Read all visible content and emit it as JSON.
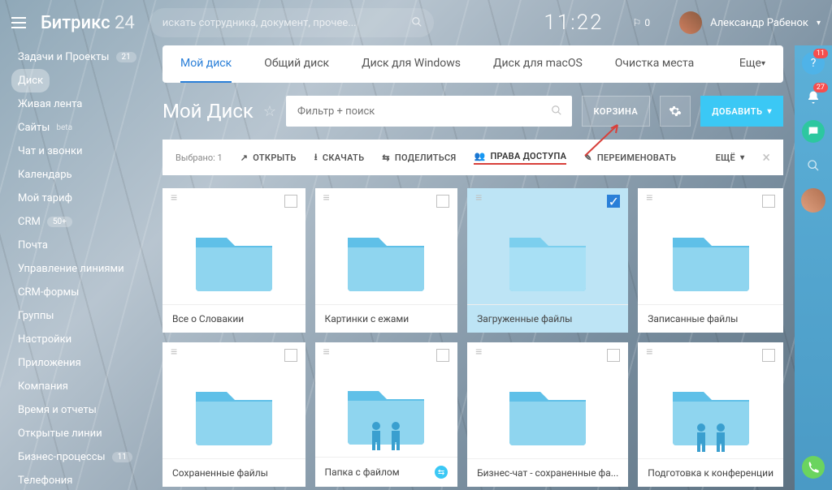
{
  "logo": {
    "main": "Битрикс",
    "sub": "24"
  },
  "search_placeholder": "искать сотрудника, документ, прочее...",
  "clock": "11:22",
  "cart_count": "0",
  "user": {
    "name": "Александр Рабенок"
  },
  "sidebar": [
    {
      "label": "Задачи и Проекты",
      "badge": "21"
    },
    {
      "label": "Диск",
      "active": true
    },
    {
      "label": "Живая лента"
    },
    {
      "label": "Сайты",
      "beta": "beta"
    },
    {
      "label": "Чат и звонки"
    },
    {
      "label": "Календарь"
    },
    {
      "label": "Мой тариф"
    },
    {
      "label": "CRM",
      "badge": "50+"
    },
    {
      "label": "Почта"
    },
    {
      "label": "Управление линиями"
    },
    {
      "label": "CRM-формы"
    },
    {
      "label": "Группы"
    },
    {
      "label": "Настройки"
    },
    {
      "label": "Приложения"
    },
    {
      "label": "Компания"
    },
    {
      "label": "Время и отчеты"
    },
    {
      "label": "Открытые линии"
    },
    {
      "label": "Бизнес-процессы",
      "badge": "11"
    },
    {
      "label": "Телефония"
    }
  ],
  "tabs": [
    {
      "label": "Мой диск",
      "active": true
    },
    {
      "label": "Общий диск"
    },
    {
      "label": "Диск для Windows"
    },
    {
      "label": "Диск для macOS"
    },
    {
      "label": "Очистка места"
    },
    {
      "label": "Еще",
      "more": true
    }
  ],
  "page_title": "Мой Диск",
  "filter_placeholder": "Фильтр + поиск",
  "btn_trash": "КОРЗИНА",
  "btn_add": "ДОБАВИТЬ",
  "selected_text": "Выбрано: 1",
  "actions": [
    {
      "label": "ОТКРЫТЬ",
      "icon": "open"
    },
    {
      "label": "СКАЧАТЬ",
      "icon": "download"
    },
    {
      "label": "ПОДЕЛИТЬСЯ",
      "icon": "share"
    },
    {
      "label": "ПРАВА ДОСТУПА",
      "icon": "rights",
      "hl": true
    },
    {
      "label": "ПЕРЕИМЕНОВАТЬ",
      "icon": "rename"
    }
  ],
  "action_more": "ЕЩЁ",
  "folders": [
    {
      "name": "Все о Словакии"
    },
    {
      "name": "Картинки с ежами"
    },
    {
      "name": "Загруженные файлы",
      "selected": true
    },
    {
      "name": "Записанные файлы"
    },
    {
      "name": "Сохраненные файлы"
    },
    {
      "name": "Папка с файлом",
      "people": true,
      "shared": true
    },
    {
      "name": "Бизнес-чат - сохраненные фа..."
    },
    {
      "name": "Подготовка к конференции",
      "people": true
    }
  ],
  "rside_badges": {
    "help": "11",
    "bell": "27"
  }
}
